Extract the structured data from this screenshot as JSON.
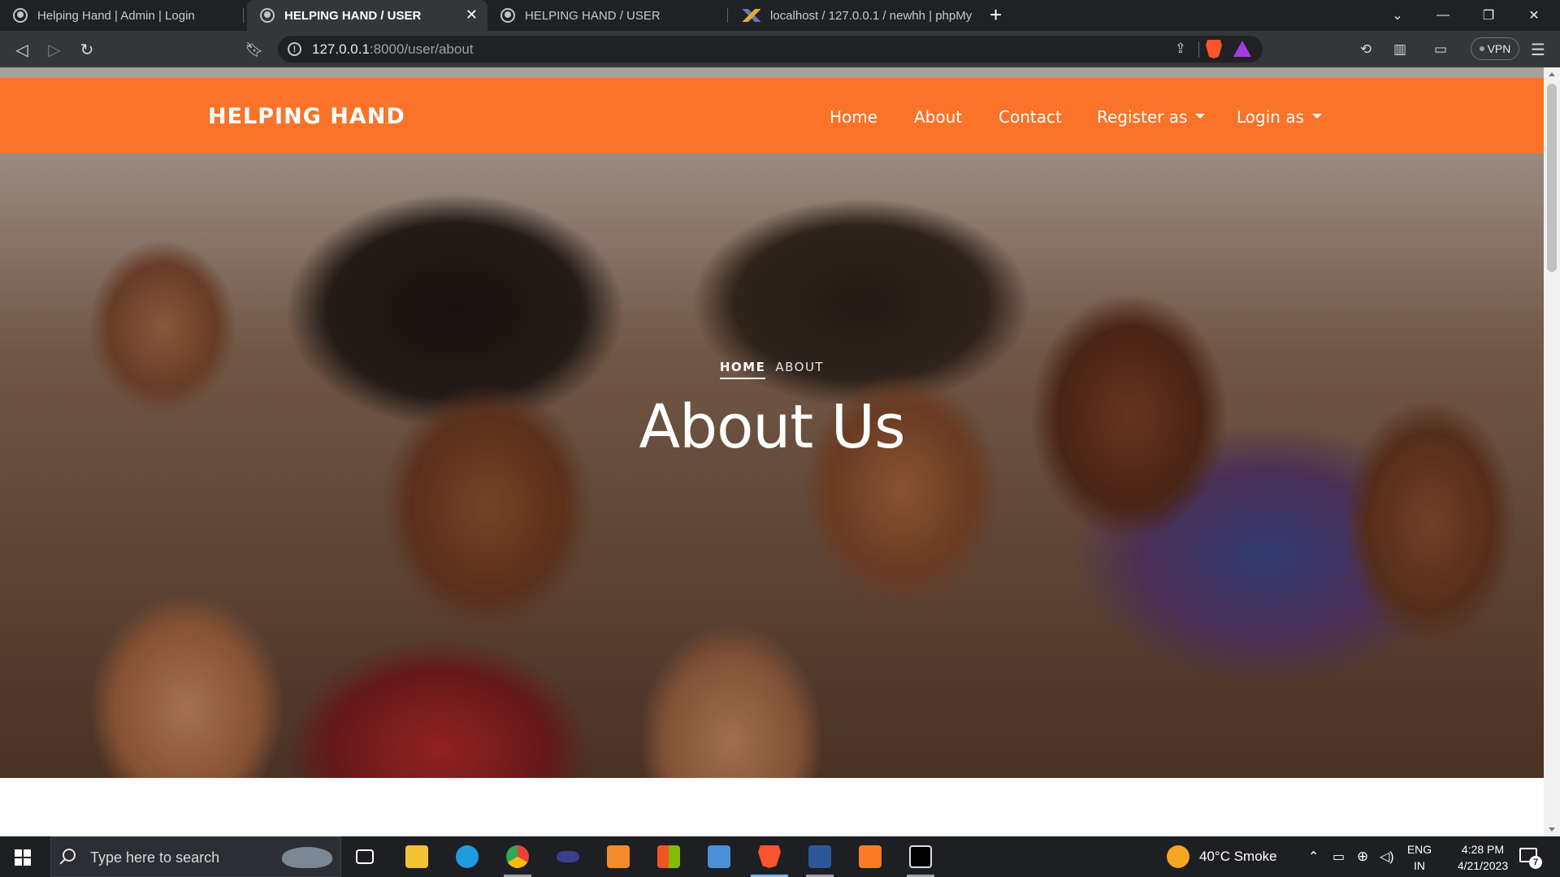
{
  "browser": {
    "tabs": [
      {
        "title": "Helping Hand | Admin | Login",
        "active": false
      },
      {
        "title": "HELPING HAND / USER",
        "active": true
      },
      {
        "title": "HELPING HAND / USER",
        "active": false
      },
      {
        "title": "localhost / 127.0.0.1 / newhh | phpMy",
        "active": false
      }
    ],
    "new_tab": "+",
    "url_host": "127.0.0.1",
    "url_path": ":8000/user/about",
    "vpn_label": "VPN",
    "controls": {
      "minimize": "—",
      "restore": "❐",
      "close": "✕",
      "tab_list": "⌄"
    }
  },
  "page": {
    "brand": "HELPING HAND",
    "nav": {
      "home": "Home",
      "about": "About",
      "contact": "Contact",
      "register": "Register as",
      "login": "Login as"
    },
    "breadcrumb": {
      "home": "HOME",
      "current": "ABOUT"
    },
    "hero_title": "About Us",
    "accent_color": "#fa7328"
  },
  "taskbar": {
    "search_placeholder": "Type here to search",
    "weather": "40°C  Smoke",
    "lang_line1": "ENG",
    "lang_line2": "IN",
    "time": "4:28 PM",
    "date": "4/21/2023",
    "notification_count": "7"
  }
}
